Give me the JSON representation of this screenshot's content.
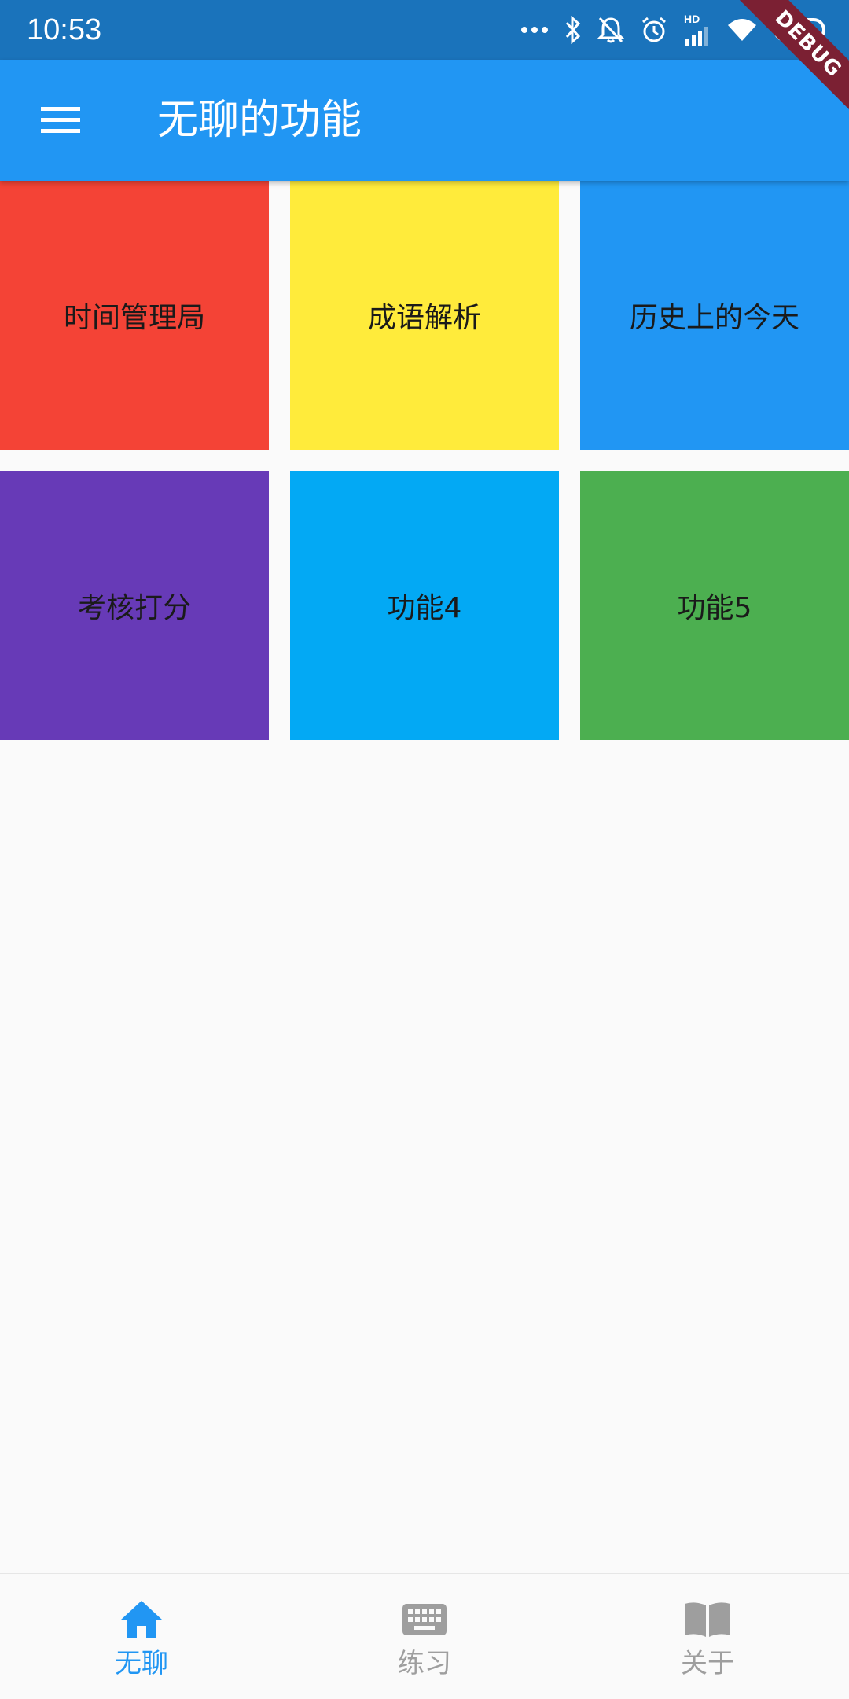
{
  "status_bar": {
    "time": "10:53",
    "battery": "39",
    "battery_level": 0.39,
    "network_label": "HD",
    "icons": [
      "more-dots-icon",
      "bluetooth-icon",
      "notifications-off-icon",
      "alarm-icon",
      "signal-icon",
      "wifi-icon",
      "battery-icon"
    ]
  },
  "debug_banner": "DEBUG",
  "app_bar": {
    "title": "无聊的功能",
    "menu_icon": "menu-icon",
    "background": "#2196f3"
  },
  "tiles": [
    {
      "label": "时间管理局",
      "color": "#f44336"
    },
    {
      "label": "成语解析",
      "color": "#ffeb3b"
    },
    {
      "label": "历史上的今天",
      "color": "#2196f3"
    },
    {
      "label": "考核打分",
      "color": "#673ab7"
    },
    {
      "label": "功能4",
      "color": "#03a9f4"
    },
    {
      "label": "功能5",
      "color": "#4caf50"
    }
  ],
  "bottom_nav": {
    "active_color": "#2196f3",
    "inactive_color": "#9e9e9e",
    "items": [
      {
        "label": "无聊",
        "icon": "home-icon",
        "active": true
      },
      {
        "label": "练习",
        "icon": "keyboard-icon",
        "active": false
      },
      {
        "label": "关于",
        "icon": "book-icon",
        "active": false
      }
    ]
  }
}
